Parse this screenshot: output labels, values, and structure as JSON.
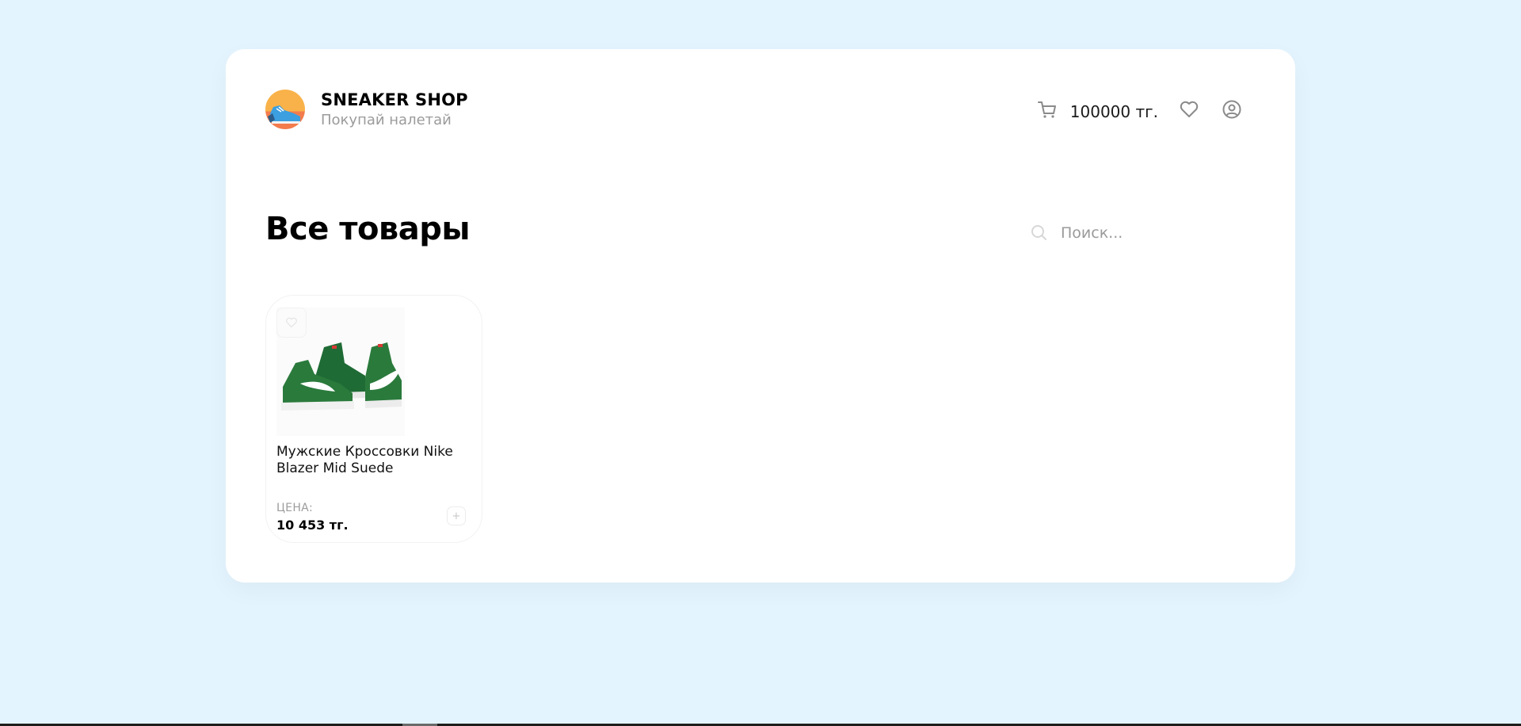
{
  "header": {
    "brand_title": "SNEAKER SHOP",
    "brand_subtitle": "Покупай налетай",
    "logo_icon": "sneaker-logo-icon",
    "cart_total": "100000 тг.",
    "cart_icon": "cart-icon",
    "favorites_icon": "heart-icon",
    "profile_icon": "user-circle-icon"
  },
  "main": {
    "title": "Все товары",
    "search": {
      "placeholder": "Поиск...",
      "value": ""
    }
  },
  "products": [
    {
      "name": "Мужские Кроссовки Nike Blazer Mid Suede",
      "price_label": "ЦЕНА:",
      "price": "10 453 тг.",
      "image": "green-sneakers-image",
      "add_label": "+"
    }
  ],
  "colors": {
    "page_background": "#e4f4fe",
    "card_background": "#ffffff",
    "muted_text": "#9b9b9b"
  }
}
